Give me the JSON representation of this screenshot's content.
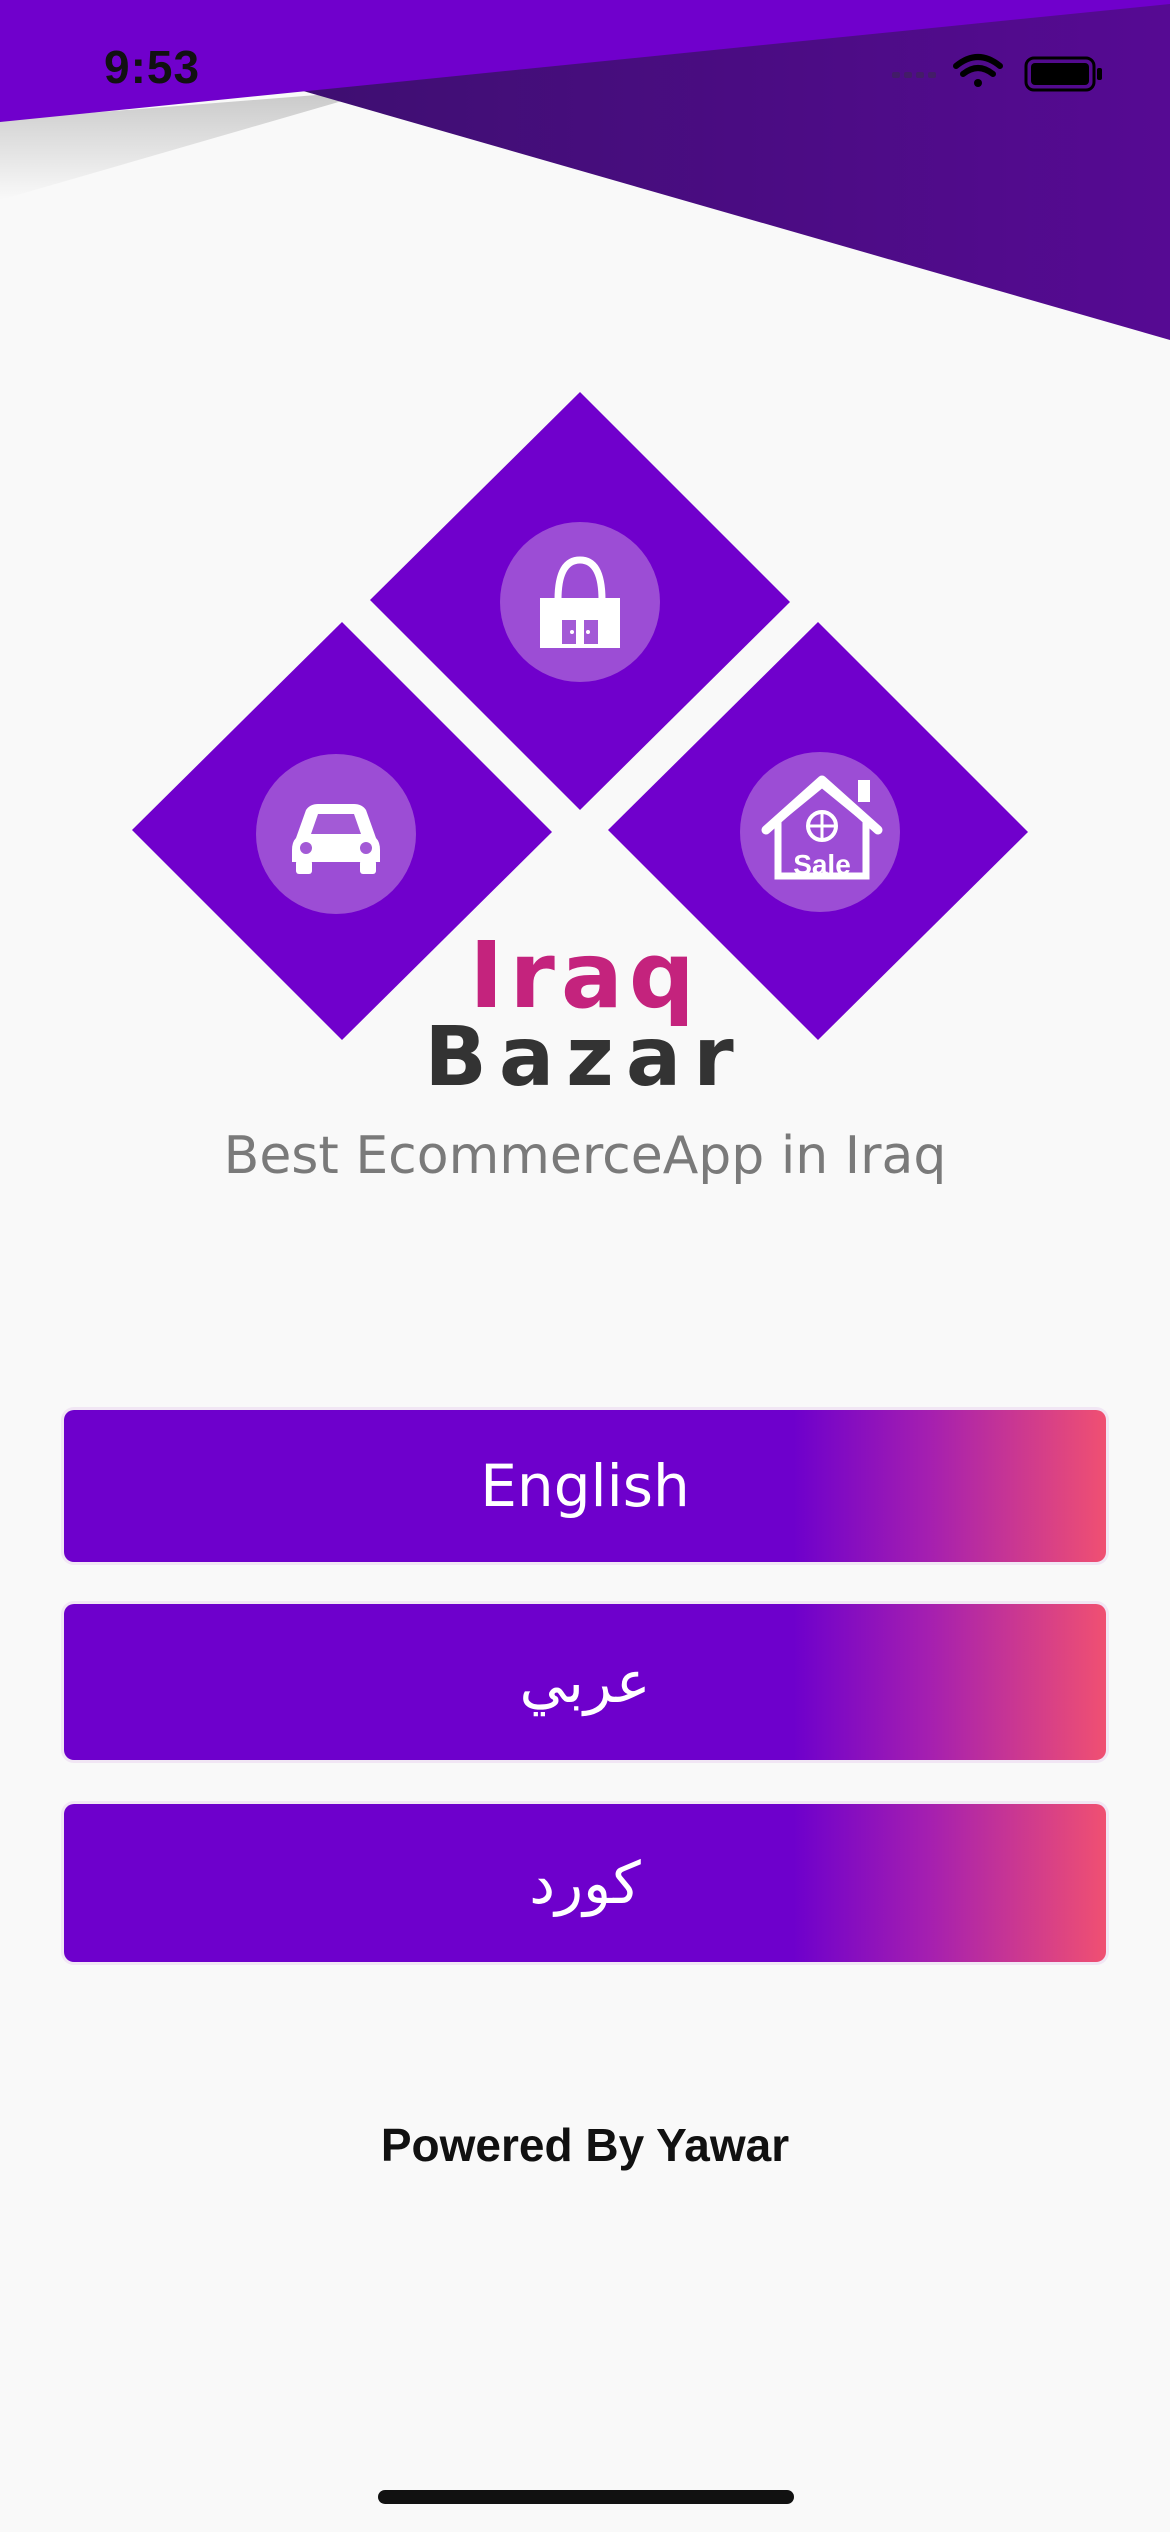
{
  "status_bar": {
    "time": "9:53",
    "icons": [
      "signal-icon",
      "wifi-icon",
      "battery-icon"
    ]
  },
  "logo": {
    "line1": "Iraq",
    "line2": "Bazar",
    "icons": [
      "shopping-bag-icon",
      "car-icon",
      "house-sale-icon"
    ],
    "house_badge_text": "Sale"
  },
  "tagline": "Best EcommerceApp in Iraq",
  "language_buttons": [
    {
      "label": "English"
    },
    {
      "label": "عربي"
    },
    {
      "label": "كورد"
    }
  ],
  "footer": {
    "powered_by": "Powered By Yawar"
  },
  "colors": {
    "brand_purple": "#6e00cc",
    "brand_pink": "#c4237d",
    "gradient_end": "#f05072",
    "dark_text": "#333333",
    "tagline_gray": "#7a7a7a",
    "background": "#f9f9f9"
  }
}
